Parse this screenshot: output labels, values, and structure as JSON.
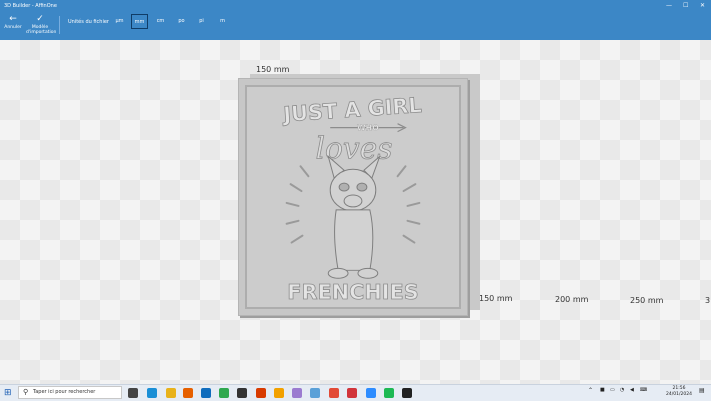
{
  "window": {
    "title": "3D Builder - AffinOne",
    "minimize": "—",
    "maximize": "☐",
    "close": "✕"
  },
  "ribbon": {
    "undo": {
      "label": "Annuler",
      "icon": "←"
    },
    "import_model": {
      "label_line1": "Modèle",
      "label_line2": "d'importation",
      "icon": "✓"
    },
    "units_label": "Unités du fichier",
    "units": [
      "µm",
      "mm",
      "cm",
      "po",
      "pi",
      "m"
    ],
    "selected_unit": "mm"
  },
  "viewport": {
    "dim_top": "150 mm",
    "dim_right": [
      "150 mm",
      "200 mm",
      "250 mm",
      "3"
    ],
    "model_text_top": "JUST A GIRL",
    "model_text_who": "WHO",
    "model_text_loves": "loves",
    "model_text_bottom": "FRENCHIES"
  },
  "taskbar": {
    "search_placeholder": "Taper ici pour rechercher",
    "time": "21:56",
    "date": "24/01/2024",
    "apps": [
      "task-view",
      "edge",
      "file-explorer",
      "firefox",
      "mail",
      "chrome",
      "terminal",
      "app-red",
      "app-orange",
      "app-paint",
      "app-notepad",
      "app-music",
      "app-store",
      "app-messenger",
      "app-spotify",
      "3d-builder"
    ],
    "app_colors": [
      "#444444",
      "#1a8fd6",
      "#e8b21b",
      "#e66000",
      "#0f6cbd",
      "#2fa84f",
      "#333333",
      "#d83b01",
      "#f2a100",
      "#9b7bd0",
      "#5aa0d8",
      "#e24a36",
      "#d1343b",
      "#2d8cff",
      "#1db954",
      "#222222"
    ]
  }
}
